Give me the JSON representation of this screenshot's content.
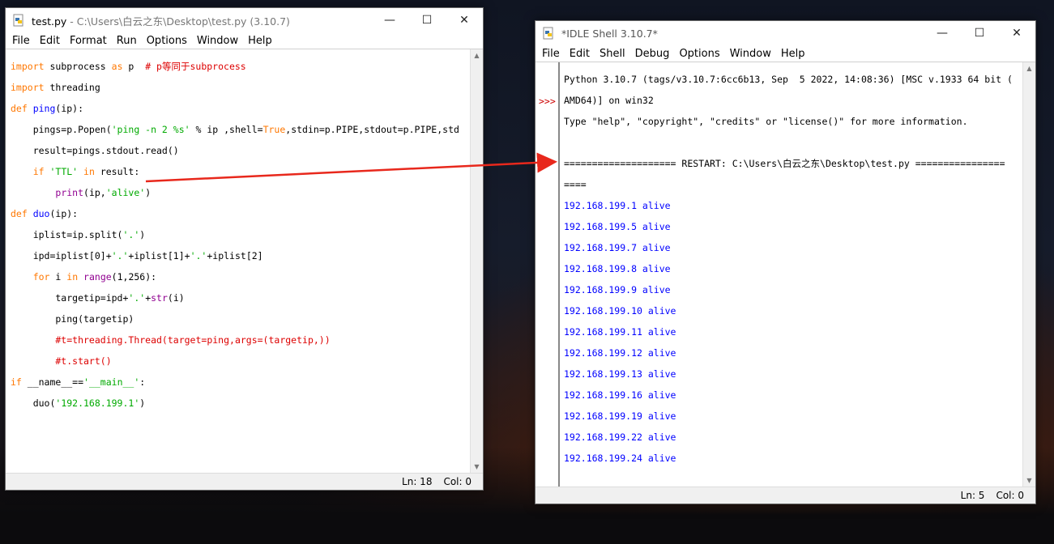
{
  "editor": {
    "title_main": "test.py",
    "title_rest": " - C:\\Users\\白云之东\\Desktop\\test.py (3.10.7)",
    "menu": [
      "File",
      "Edit",
      "Format",
      "Run",
      "Options",
      "Window",
      "Help"
    ],
    "status_line": "Ln: 18",
    "status_col": "Col: 0"
  },
  "shell": {
    "title": "*IDLE Shell 3.10.7*",
    "menu": [
      "File",
      "Edit",
      "Shell",
      "Debug",
      "Options",
      "Window",
      "Help"
    ],
    "prompt": ">>>",
    "banner1": "Python 3.10.7 (tags/v3.10.7:6cc6b13, Sep  5 2022, 14:08:36) [MSC v.1933 64 bit (",
    "banner2": "AMD64)] on win32",
    "banner3": "Type \"help\", \"copyright\", \"credits\" or \"license()\" for more information.",
    "restart1": "==================== RESTART: C:\\Users\\白云之东\\Desktop\\test.py ================",
    "restart2": "====",
    "outputs": [
      "192.168.199.1 alive",
      "192.168.199.5 alive",
      "192.168.199.7 alive",
      "192.168.199.8 alive",
      "192.168.199.9 alive",
      "192.168.199.10 alive",
      "192.168.199.11 alive",
      "192.168.199.12 alive",
      "192.168.199.13 alive",
      "192.168.199.16 alive",
      "192.168.199.19 alive",
      "192.168.199.22 alive",
      "192.168.199.24 alive"
    ],
    "status_line": "Ln: 5",
    "status_col": "Col: 0"
  },
  "code": {
    "l1_kw1": "import",
    "l1_t1": " subprocess ",
    "l1_kw2": "as",
    "l1_t2": " p  ",
    "l1_cm": "# p等同于subprocess",
    "l2_kw": "import",
    "l2_t": " threading",
    "l3_kw": "def",
    "l3_fn": " ping",
    "l3_t": "(ip):",
    "l4_t1": "    pings=p.Popen(",
    "l4_st": "'ping -n 2 %s'",
    "l4_t2": " % ip ,shell=",
    "l4_kw": "True",
    "l4_t3": ",stdin=p.PIPE,stdout=p.PIPE,std",
    "l5_t": "    result=pings.stdout.read()",
    "l6_pre": "    ",
    "l6_kw1": "if",
    "l6_st": " 'TTL' ",
    "l6_kw2": "in",
    "l6_t": " result:",
    "l7_pre": "        ",
    "l7_bi": "print",
    "l7_t1": "(ip,",
    "l7_st": "'alive'",
    "l7_t2": ")",
    "l8_kw": "def",
    "l8_fn": " duo",
    "l8_t": "(ip):",
    "l9_t1": "    iplist=ip.split(",
    "l9_st": "'.'",
    "l9_t2": ")",
    "l10_t1": "    ipd=iplist[0]+",
    "l10_st1": "'.'",
    "l10_t2": "+iplist[1]+",
    "l10_st2": "'.'",
    "l10_t3": "+iplist[2]",
    "l11_pre": "    ",
    "l11_kw1": "for",
    "l11_t1": " i ",
    "l11_kw2": "in",
    "l11_bi": " range",
    "l11_t2": "(1,256):",
    "l12_t1": "        targetip=ipd+",
    "l12_st": "'.'",
    "l12_t2": "+",
    "l12_bi": "str",
    "l12_t3": "(i)",
    "l13_t": "        ping(targetip)",
    "l14_cm": "        #t=threading.Thread(target=ping,args=(targetip,))",
    "l15_cm": "        #t.start()",
    "l16_kw": "if",
    "l16_t1": " __name__==",
    "l16_st": "'__main__'",
    "l16_t2": ":",
    "l17_t1": "    duo(",
    "l17_st": "'192.168.199.1'",
    "l17_t2": ")"
  },
  "colors": {
    "keyword": "#ff7700",
    "builtin": "#900090",
    "string": "#00aa00",
    "comment": "#dd0000",
    "output": "#0000ff",
    "arrow": "#e8281c"
  }
}
